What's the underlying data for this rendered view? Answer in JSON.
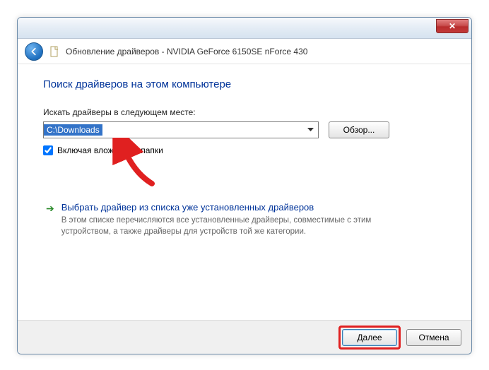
{
  "titlebar": {
    "close_glyph": "✕"
  },
  "header": {
    "title": "Обновление драйверов - NVIDIA GeForce 6150SE nForce 430"
  },
  "content": {
    "heading": "Поиск драйверов на этом компьютере",
    "path_label": "Искать драйверы в следующем месте:",
    "path_value": "C:\\Downloads",
    "browse_label": "Обзор...",
    "include_subfolders_label": "Включая вложенные папки",
    "include_subfolders_checked": true,
    "pick_option": {
      "title": "Выбрать драйвер из списка уже установленных драйверов",
      "desc": "В этом списке перечисляются все установленные драйверы, совместимые с этим устройством, а также драйверы для устройств той же категории."
    }
  },
  "footer": {
    "next_label": "Далее",
    "cancel_label": "Отмена"
  }
}
